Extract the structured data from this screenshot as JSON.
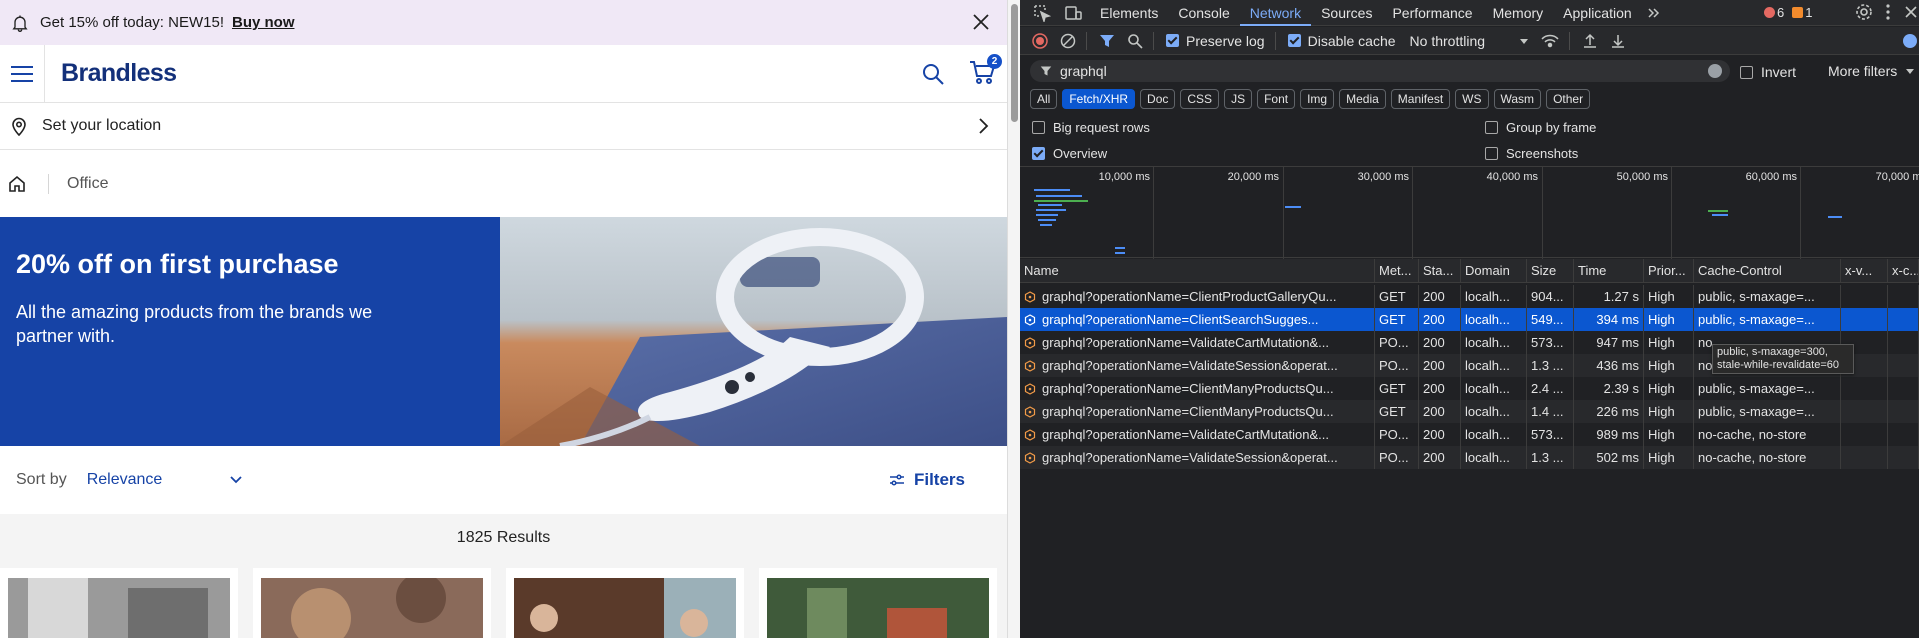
{
  "promo": {
    "text": "Get 15% off today: NEW15!",
    "cta": "Buy now"
  },
  "header": {
    "logo": "Brandless",
    "cart_count": "2"
  },
  "location": {
    "label": "Set your location"
  },
  "breadcrumb": {
    "current": "Office"
  },
  "hero": {
    "title": "20% off on first purchase",
    "subtitle": "All the amazing products from the brands we partner with."
  },
  "sort": {
    "label": "Sort by",
    "value": "Relevance",
    "filters_label": "Filters"
  },
  "results": {
    "text": "1825 Results"
  },
  "devtools": {
    "tabs": [
      "Elements",
      "Console",
      "Network",
      "Sources",
      "Performance",
      "Memory",
      "Application"
    ],
    "active_tab": "Network",
    "error_count": "6",
    "warning_count": "1",
    "toolbar": {
      "preserve_log": "Preserve log",
      "disable_cache": "Disable cache",
      "throttling": "No throttling"
    },
    "filter": {
      "value": "graphql",
      "invert": "Invert",
      "more_filters": "More filters"
    },
    "type_filters": [
      "All",
      "Fetch/XHR",
      "Doc",
      "CSS",
      "JS",
      "Font",
      "Img",
      "Media",
      "Manifest",
      "WS",
      "Wasm",
      "Other"
    ],
    "active_type": "Fetch/XHR",
    "options": {
      "big_rows": "Big request rows",
      "overview": "Overview",
      "group_by_frame": "Group by frame",
      "screenshots": "Screenshots"
    },
    "timeline_ticks": [
      "10,000 ms",
      "20,000 ms",
      "30,000 ms",
      "40,000 ms",
      "50,000 ms",
      "60,000 ms",
      "70,000 ms"
    ],
    "columns": [
      "Name",
      "Met...",
      "Sta...",
      "Domain",
      "Size",
      "Time",
      "Prior...",
      "Cache-Control",
      "x-v...",
      "x-c..."
    ],
    "rows": [
      {
        "name": "graphql?operationName=ClientProductGalleryQu...",
        "method": "GET",
        "status": "200",
        "domain": "localh...",
        "size": "904...",
        "time": "1.27 s",
        "priority": "High",
        "cache": "public, s-maxage=..."
      },
      {
        "name": "graphql?operationName=ClientSearchSugges...",
        "method": "GET",
        "status": "200",
        "domain": "localh...",
        "size": "549...",
        "time": "394 ms",
        "priority": "High",
        "cache": "public, s-maxage=..."
      },
      {
        "name": "graphql?operationName=ValidateCartMutation&...",
        "method": "PO...",
        "status": "200",
        "domain": "localh...",
        "size": "573...",
        "time": "947 ms",
        "priority": "High",
        "cache": "no"
      },
      {
        "name": "graphql?operationName=ValidateSession&operat...",
        "method": "PO...",
        "status": "200",
        "domain": "localh...",
        "size": "1.3 ...",
        "time": "436 ms",
        "priority": "High",
        "cache": "no"
      },
      {
        "name": "graphql?operationName=ClientManyProductsQu...",
        "method": "GET",
        "status": "200",
        "domain": "localh...",
        "size": "2.4 ...",
        "time": "2.39 s",
        "priority": "High",
        "cache": "public, s-maxage=..."
      },
      {
        "name": "graphql?operationName=ClientManyProductsQu...",
        "method": "GET",
        "status": "200",
        "domain": "localh...",
        "size": "1.4 ...",
        "time": "226 ms",
        "priority": "High",
        "cache": "public, s-maxage=..."
      },
      {
        "name": "graphql?operationName=ValidateCartMutation&...",
        "method": "PO...",
        "status": "200",
        "domain": "localh...",
        "size": "573...",
        "time": "989 ms",
        "priority": "High",
        "cache": "no-cache, no-store"
      },
      {
        "name": "graphql?operationName=ValidateSession&operat...",
        "method": "PO...",
        "status": "200",
        "domain": "localh...",
        "size": "1.3 ...",
        "time": "502 ms",
        "priority": "High",
        "cache": "no-cache, no-store"
      }
    ],
    "tooltip": "public, s-maxage=300, stale-while-revalidate=60"
  },
  "colors": {
    "brand": "#13307a",
    "hero_bg": "#1643a6",
    "devtools_bg": "#202124",
    "selected_row": "#0b57d0",
    "active_tab": "#7cacf8"
  }
}
